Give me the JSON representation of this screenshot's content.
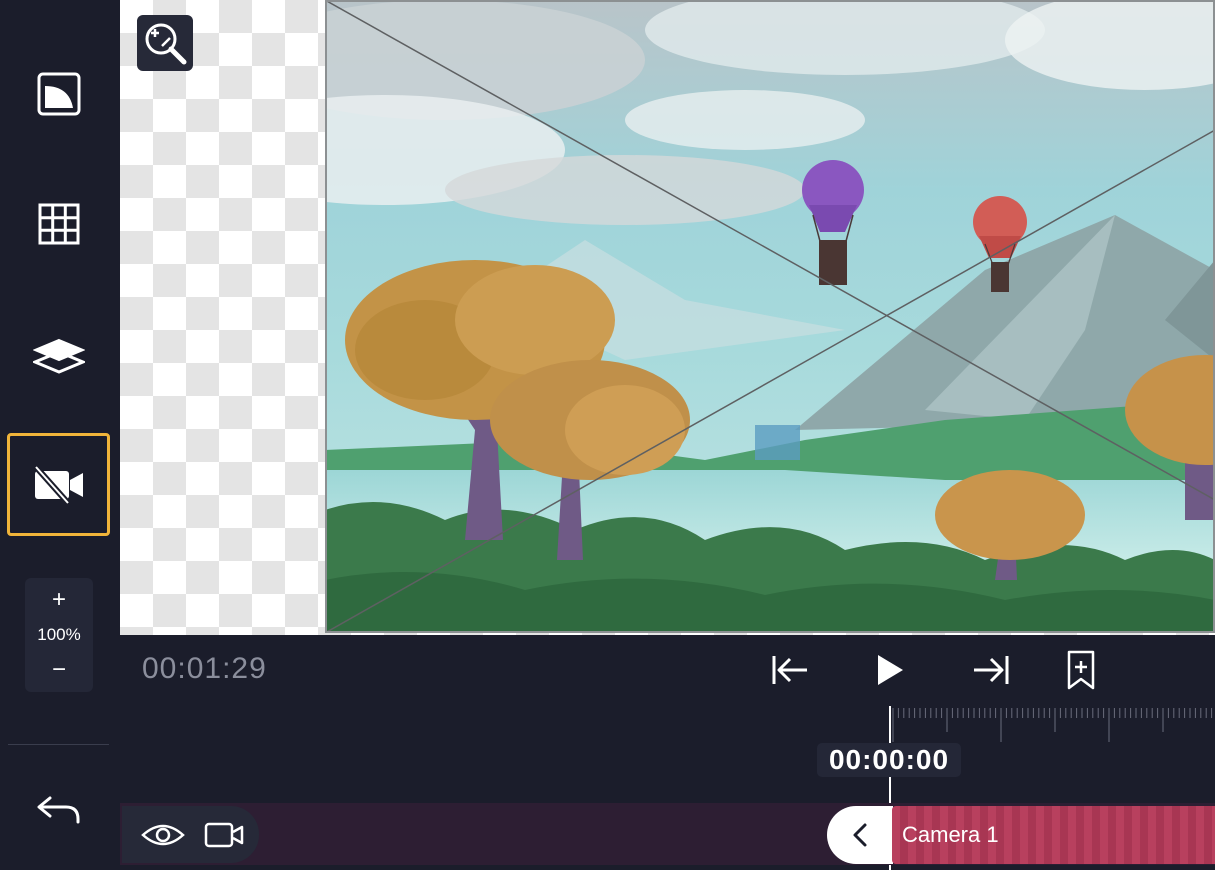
{
  "sidebar": {
    "buttons": [
      {
        "name": "canvas-shape-button",
        "icon": "canvas-corner-icon"
      },
      {
        "name": "grid-button",
        "icon": "grid-icon"
      },
      {
        "name": "layers-button",
        "icon": "layers-icon"
      },
      {
        "name": "camera-toggle-button",
        "icon": "camera-off-icon",
        "active": true
      }
    ],
    "zoom": {
      "plus": "+",
      "level": "100%",
      "minus": "−"
    },
    "undo_icon": "undo-arrow-icon"
  },
  "canvas": {
    "zoom_tool_icon": "zoom-magnifier-icon"
  },
  "timeline": {
    "timecode": "00:01:29",
    "playhead_time": "00:00:00",
    "controls": [
      "skip-to-start-icon",
      "play-icon",
      "skip-to-end-icon",
      "add-bookmark-icon"
    ],
    "track": {
      "visibility_icon": "eye-icon",
      "type_icon": "video-camera-icon",
      "collapse_label": "<",
      "clip_label": "Camera 1"
    }
  },
  "colors": {
    "background": "#1b1d2b",
    "active_outline": "#f0b43a",
    "clip": "#b8405e"
  }
}
